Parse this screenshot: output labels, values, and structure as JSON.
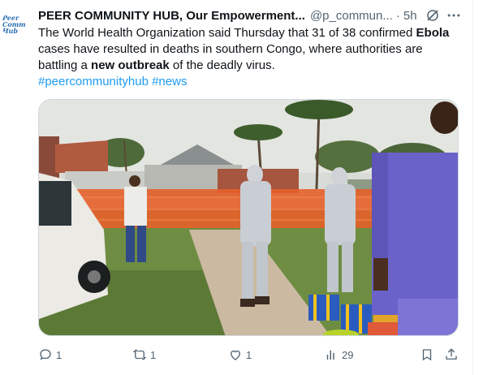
{
  "tweet": {
    "author_name": "PEER COMMUNITY HUB, Our Empowerment...",
    "handle": "@p_commun...",
    "separator": "·",
    "time": "5h",
    "avatar_logo": "Peer Comm Hub",
    "text_parts": [
      {
        "t": "The World Health Organization said Thursday that 31 of 38 confirmed ",
        "b": false
      },
      {
        "t": "Ebola",
        "b": true
      },
      {
        "t": " cases have resulted in deaths in southern Congo, where authorities are battling a ",
        "b": false
      },
      {
        "t": "new outbreak",
        "b": true
      },
      {
        "t": " of the deadly virus.",
        "b": false
      }
    ],
    "hashtags": [
      "#peercommunityhub",
      "#news"
    ],
    "media": {
      "icon": "photo"
    },
    "actions": {
      "reply_count": "1",
      "repost_count": "1",
      "like_count": "1",
      "views_count": "29"
    }
  },
  "colors": {
    "accent": "#1d9bf0",
    "secondary_text": "#536471",
    "primary_text": "#0f1419",
    "border": "#cfd9de"
  }
}
